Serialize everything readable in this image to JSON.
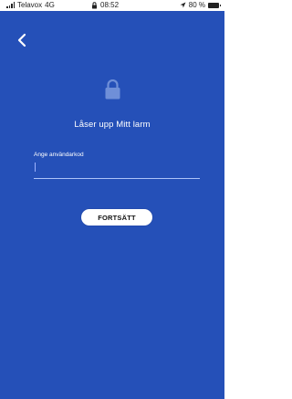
{
  "status_bar": {
    "carrier": "Telavox",
    "network": "4G",
    "time": "08:52",
    "battery": "80 %"
  },
  "screen": {
    "title": "Låser upp Mitt larm",
    "field_label": "Ange användarkod",
    "button_label": "FORTSÄTT"
  },
  "colors": {
    "background": "#2550B8",
    "accent": "#9fb4ff",
    "button_bg": "#ffffff",
    "lock_icon": "#6f8fd8"
  },
  "icons": [
    "signal-icon",
    "lock-small-icon",
    "location-arrow-icon",
    "battery-icon",
    "back-chevron-icon",
    "lock-icon"
  ]
}
